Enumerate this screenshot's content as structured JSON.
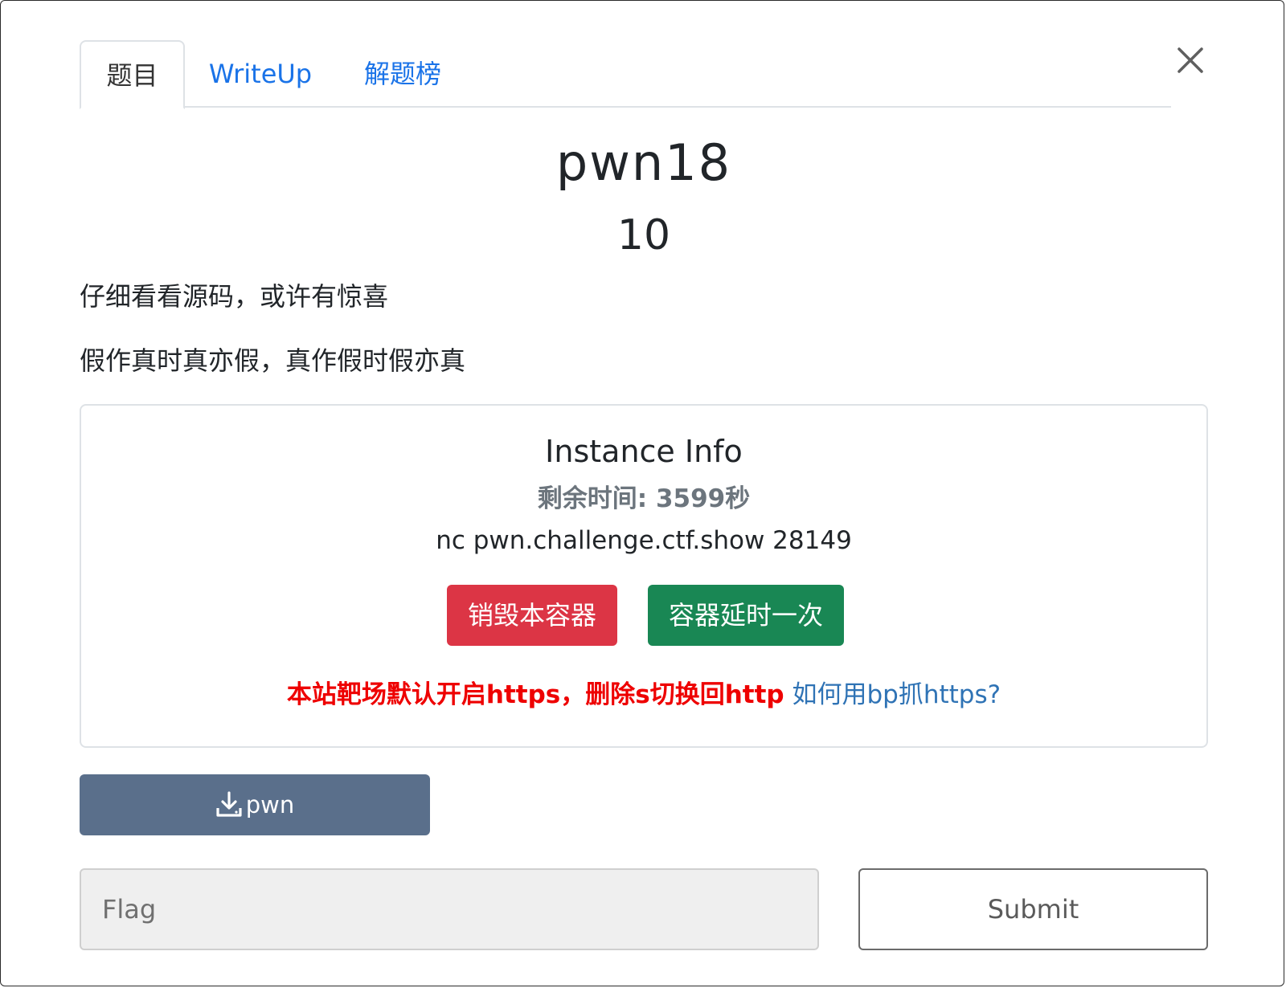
{
  "tabs": [
    {
      "label": "题目",
      "active": true
    },
    {
      "label": "WriteUp",
      "active": false
    },
    {
      "label": "解题榜",
      "active": false
    }
  ],
  "close_icon": "close-icon",
  "challenge": {
    "name": "pwn18",
    "score": "10",
    "description": [
      "仔细看看源码，或许有惊喜",
      "假作真时真亦假，真作假时假亦真"
    ]
  },
  "instance": {
    "title": "Instance Info",
    "remaining_time": "剩余时间: 3599秒",
    "command": "nc pwn.challenge.ctf.show 28149",
    "destroy_label": "销毁本容器",
    "extend_label": "容器延时一次",
    "note_red": "本站靶场默认开启https，删除s切换回http",
    "note_link": "如何用bp抓https?"
  },
  "download": {
    "label": "pwn",
    "icon": "download-icon"
  },
  "flag_form": {
    "placeholder": "Flag",
    "value": "",
    "submit_label": "Submit"
  },
  "colors": {
    "tab_link": "#1a73e8",
    "destroy": "#dc3545",
    "extend": "#198754",
    "download": "#5a6f8b",
    "note_red": "#ee0000",
    "note_link": "#2f73b5"
  }
}
